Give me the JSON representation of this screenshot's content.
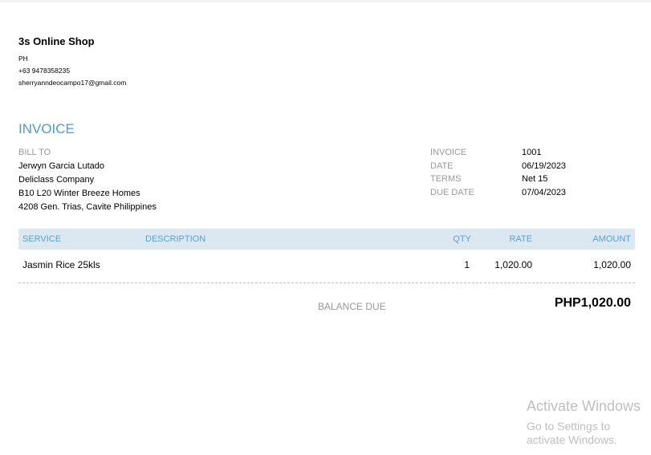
{
  "company": {
    "name": "3s Online Shop",
    "country": "PH",
    "phone": "+63 9478358235",
    "email": "sherryanndeocampo17@gmail.com"
  },
  "invoice_title": "INVOICE",
  "bill_to": {
    "label": "BILL TO",
    "lines": [
      "Jerwyn Garcia Lutado",
      "Deliclass Company",
      "B10 L20 Winter Breeze Homes",
      "4208 Gen. Trias, Cavite Philippines"
    ]
  },
  "meta": [
    {
      "label": "INVOICE",
      "value": "1001"
    },
    {
      "label": "DATE",
      "value": "06/19/2023"
    },
    {
      "label": "TERMS",
      "value": "Net 15"
    },
    {
      "label": "DUE DATE",
      "value": "07/04/2023"
    }
  ],
  "table": {
    "headers": {
      "service": "SERVICE",
      "description": "DESCRIPTION",
      "qty": "QTY",
      "rate": "RATE",
      "amount": "AMOUNT"
    },
    "rows": [
      {
        "service": "Jasmin Rice 25kls",
        "description": "",
        "qty": "1",
        "rate": "1,020.00",
        "amount": "1,020.00"
      }
    ]
  },
  "balance": {
    "label": "BALANCE DUE",
    "value": "PHP1,020.00"
  },
  "watermark": {
    "line1": "Activate Windows",
    "line2": "Go to Settings to activate Windows."
  }
}
